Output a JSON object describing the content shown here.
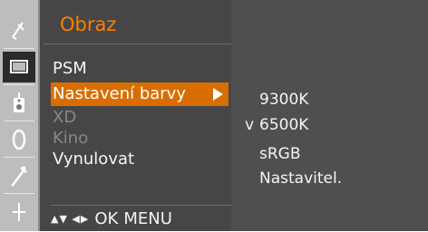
{
  "sidebar": {
    "icons": [
      {
        "name": "antenna-icon",
        "glyph": "✈"
      },
      {
        "name": "picture-icon",
        "glyph": "▢"
      },
      {
        "name": "sound-icon",
        "glyph": "♪"
      },
      {
        "name": "time-icon",
        "glyph": "◔"
      },
      {
        "name": "option-icon",
        "glyph": "✎"
      },
      {
        "name": "screen-icon",
        "glyph": "✚"
      }
    ]
  },
  "menu": {
    "title": "Obraz",
    "items": [
      {
        "label": "PSM",
        "state": "normal"
      },
      {
        "label": "Nastavení barvy",
        "state": "selected"
      },
      {
        "label": "XD",
        "state": "disabled"
      },
      {
        "label": "Kino",
        "state": "disabled"
      },
      {
        "label": "Vynulovat",
        "state": "normal"
      }
    ]
  },
  "submenu": {
    "items": [
      {
        "label": "9300K",
        "checked": ""
      },
      {
        "label": "6500K",
        "checked": "v"
      },
      {
        "label": "sRGB",
        "checked": ""
      },
      {
        "label": "Nastavitel.",
        "checked": ""
      }
    ]
  },
  "footer": {
    "nav_glyphs": "▲▼ ◀▶",
    "ok_label": "OK",
    "menu_label": "MENU"
  },
  "colors": {
    "accent": "#ff7e00",
    "selected_bg": "#d86e00",
    "disabled_text": "#888888"
  }
}
